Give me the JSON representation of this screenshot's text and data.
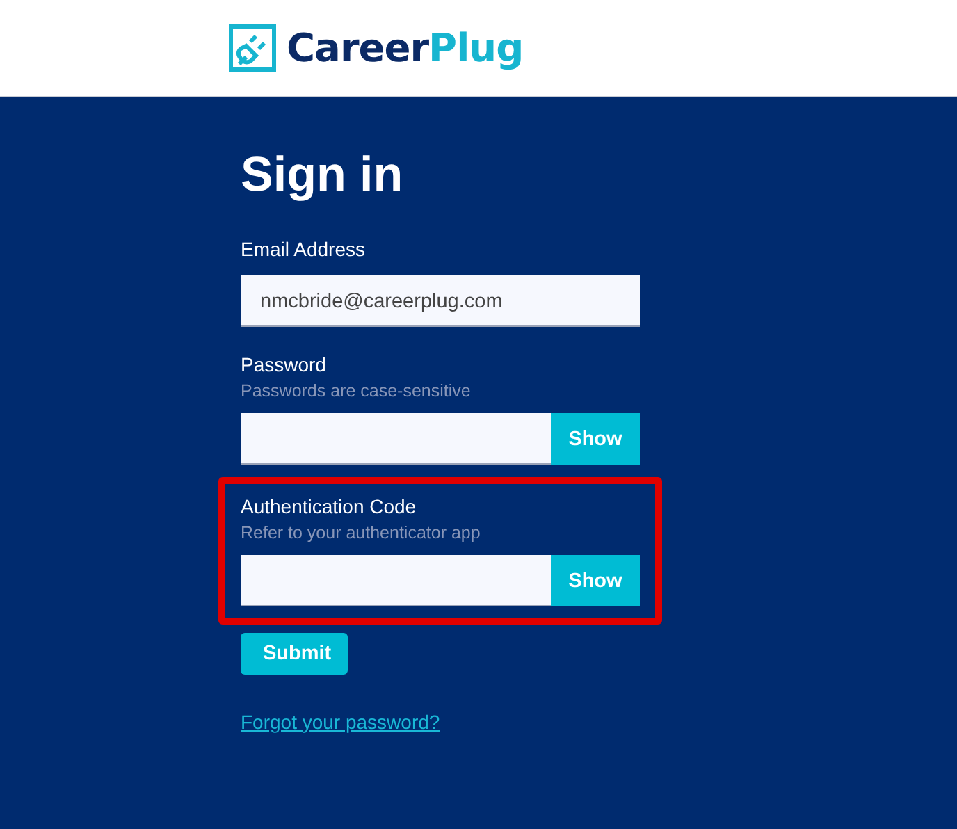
{
  "logo": {
    "parts": [
      "Career",
      "Plug"
    ]
  },
  "heading": "Sign in",
  "fields": [
    {
      "kind": "text",
      "label": "Email Address",
      "value": "nmcbride@careerplug.com",
      "highlighted": false
    },
    {
      "kind": "password",
      "label": "Password",
      "hint": "Passwords are case-sensitive",
      "button": "Show",
      "highlighted": false
    },
    {
      "kind": "password",
      "label": "Authentication Code",
      "hint": "Refer to your authenticator app",
      "button": "Show",
      "highlighted": true
    }
  ],
  "submit": "Submit",
  "link": "Forgot your password?"
}
